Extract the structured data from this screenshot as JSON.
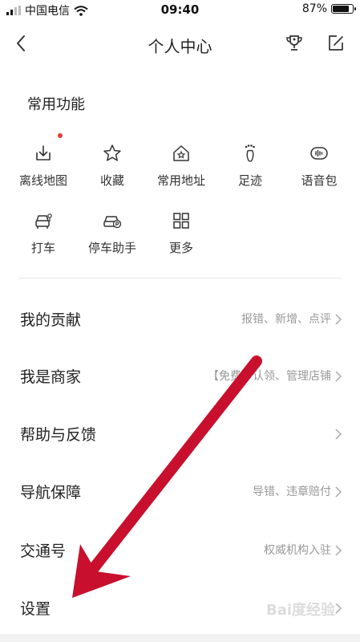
{
  "status_bar": {
    "carrier": "中国电信",
    "time": "09:40",
    "battery_text": "87%",
    "battery_level": 0.87
  },
  "nav": {
    "title": "个人中心",
    "back_icon": "chevron-left-icon",
    "trophy_icon": "trophy-icon",
    "edit_icon": "edit-icon"
  },
  "common": {
    "title": "常用功能",
    "items": [
      {
        "label": "离线地图",
        "icon": "download-tray-icon"
      },
      {
        "label": "收藏",
        "icon": "star-icon"
      },
      {
        "label": "常用地址",
        "icon": "home-star-icon"
      },
      {
        "label": "足迹",
        "icon": "footprint-icon"
      },
      {
        "label": "语音包",
        "icon": "voice-icon"
      },
      {
        "label": "打车",
        "icon": "taxi-icon"
      },
      {
        "label": "停车助手",
        "icon": "parking-car-icon"
      },
      {
        "label": "更多",
        "icon": "grid-icon"
      }
    ]
  },
  "menu": [
    {
      "label": "我的贡献",
      "hint": "报错、新增、点评"
    },
    {
      "label": "我是商家",
      "hint": "【免费】认领、管理店铺"
    },
    {
      "label": "帮助与反馈",
      "hint": ""
    },
    {
      "label": "导航保障",
      "hint": "导错、违章赔付"
    },
    {
      "label": "交通号",
      "hint": "权威机构入驻"
    },
    {
      "label": "设置",
      "hint": ""
    }
  ],
  "colors": {
    "accent_red": "#c8102e",
    "notification_dot": "#e53935",
    "hint_gray": "#999999"
  },
  "watermark": "Bai度经验"
}
